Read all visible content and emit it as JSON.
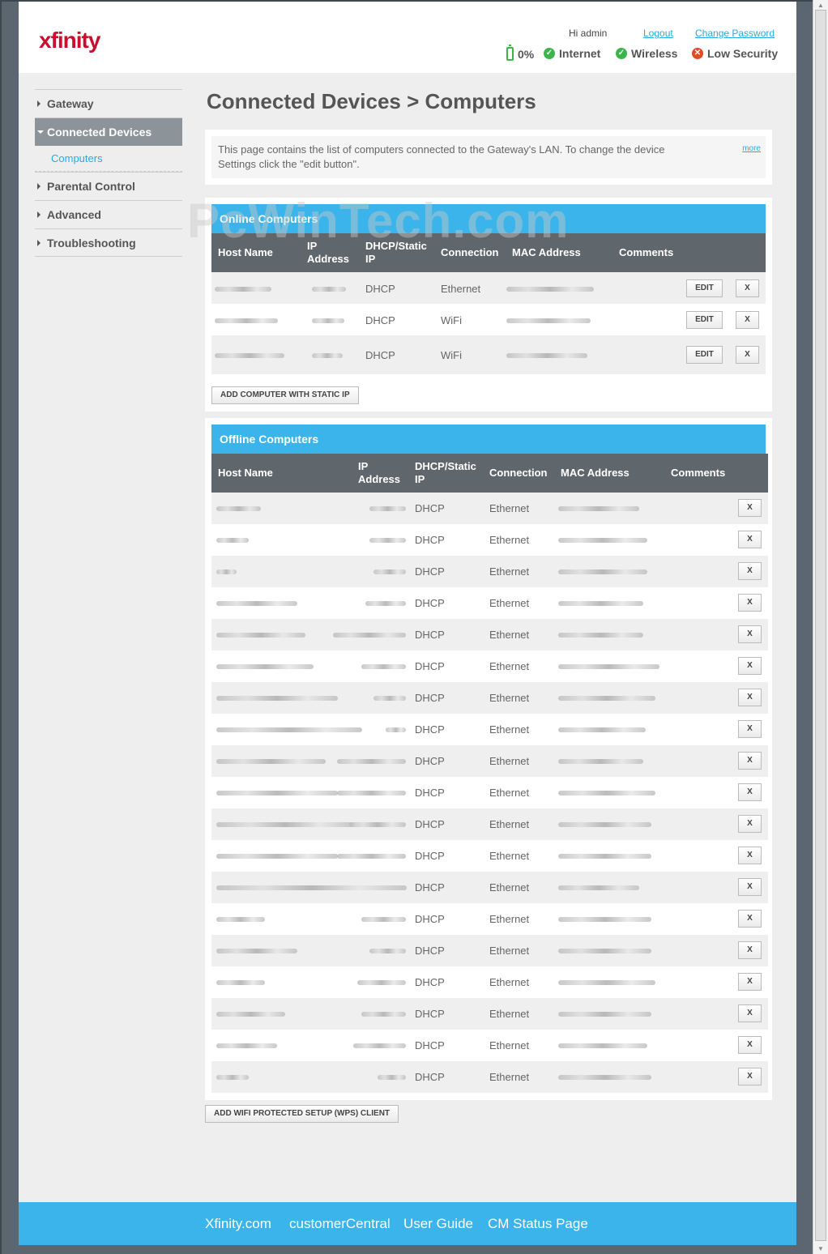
{
  "header": {
    "logo": "xfinity",
    "greeting": "Hi admin",
    "logout": "Logout",
    "change_password": "Change Password",
    "status": [
      {
        "label": "0%",
        "icon": "battery-icon"
      },
      {
        "label": "Internet",
        "icon": "check-icon"
      },
      {
        "label": "Wireless",
        "icon": "check-icon"
      },
      {
        "label": "Low Security",
        "icon": "error-icon"
      }
    ]
  },
  "nav": {
    "gateway": "Gateway",
    "connected_devices": "Connected Devices",
    "computers": "Computers",
    "parental_control": "Parental Control",
    "advanced": "Advanced",
    "troubleshooting": "Troubleshooting"
  },
  "page_title": "Connected Devices > Computers",
  "info": {
    "text": "This page contains the list of computers connected to the Gateway's LAN. To change the device Settings click the \"edit button\".",
    "more": "more"
  },
  "watermark": "PcWinTech.com",
  "online": {
    "title": "Online Computers",
    "headers": {
      "host": "Host Name",
      "ip": "IP Address",
      "dhcp": "DHCP/Static IP",
      "conn": "Connection",
      "mac": "MAC Address",
      "comments": "Comments"
    },
    "rows": [
      {
        "dhcp": "DHCP",
        "conn": "Ethernet"
      },
      {
        "dhcp": "DHCP",
        "conn": "WiFi"
      },
      {
        "dhcp": "DHCP",
        "conn": "WiFi"
      }
    ],
    "edit_label": "EDIT",
    "delete_label": "X",
    "add_button": "ADD COMPUTER WITH STATIC IP"
  },
  "offline": {
    "title": "Offline Computers",
    "headers": {
      "host": "Host Name",
      "ip": "IP Address",
      "dhcp": "DHCP/Static IP",
      "conn": "Connection",
      "mac": "MAC Address",
      "comments": "Comments"
    },
    "rows": [
      {
        "dhcp": "DHCP",
        "conn": "Ethernet"
      },
      {
        "dhcp": "DHCP",
        "conn": "Ethernet"
      },
      {
        "dhcp": "DHCP",
        "conn": "Ethernet"
      },
      {
        "dhcp": "DHCP",
        "conn": "Ethernet"
      },
      {
        "dhcp": "DHCP",
        "conn": "Ethernet"
      },
      {
        "dhcp": "DHCP",
        "conn": "Ethernet"
      },
      {
        "dhcp": "DHCP",
        "conn": "Ethernet"
      },
      {
        "dhcp": "DHCP",
        "conn": "Ethernet"
      },
      {
        "dhcp": "DHCP",
        "conn": "Ethernet"
      },
      {
        "dhcp": "DHCP",
        "conn": "Ethernet"
      },
      {
        "dhcp": "DHCP",
        "conn": "Ethernet"
      },
      {
        "dhcp": "DHCP",
        "conn": "Ethernet"
      },
      {
        "dhcp": "DHCP",
        "conn": "Ethernet"
      },
      {
        "dhcp": "DHCP",
        "conn": "Ethernet"
      },
      {
        "dhcp": "DHCP",
        "conn": "Ethernet"
      },
      {
        "dhcp": "DHCP",
        "conn": "Ethernet"
      },
      {
        "dhcp": "DHCP",
        "conn": "Ethernet"
      },
      {
        "dhcp": "DHCP",
        "conn": "Ethernet"
      },
      {
        "dhcp": "DHCP",
        "conn": "Ethernet"
      }
    ],
    "delete_label": "X"
  },
  "wps_button": "ADD WIFI PROTECTED SETUP (WPS) CLIENT",
  "footer": {
    "links": [
      "Xfinity.com",
      "customerCentral",
      "User Guide",
      "CM Status Page"
    ]
  },
  "colors": {
    "accent": "#3ab4ea",
    "brand": "#c8102e",
    "header_row": "#5f676c",
    "ok": "#3cb54a",
    "alert": "#e24b26"
  }
}
